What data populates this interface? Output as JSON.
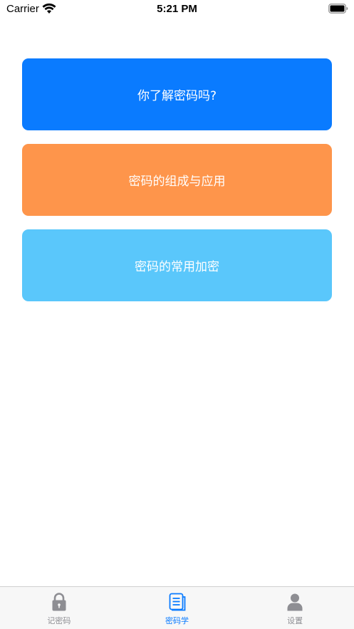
{
  "status_bar": {
    "carrier": "Carrier",
    "time": "5:21 PM"
  },
  "menu": {
    "items": [
      {
        "label": "你了解密码吗?",
        "color": "#0a7bff"
      },
      {
        "label": "密码的组成与应用",
        "color": "#fe954b"
      },
      {
        "label": "密码的常用加密",
        "color": "#5ac7fb"
      }
    ]
  },
  "tab_bar": {
    "tabs": [
      {
        "label": "记密码",
        "icon": "lock-icon",
        "active": false
      },
      {
        "label": "密码学",
        "icon": "document-icon",
        "active": true
      },
      {
        "label": "设置",
        "icon": "person-icon",
        "active": false
      }
    ],
    "active_color": "#0a7bff",
    "inactive_color": "#8e8e93"
  }
}
